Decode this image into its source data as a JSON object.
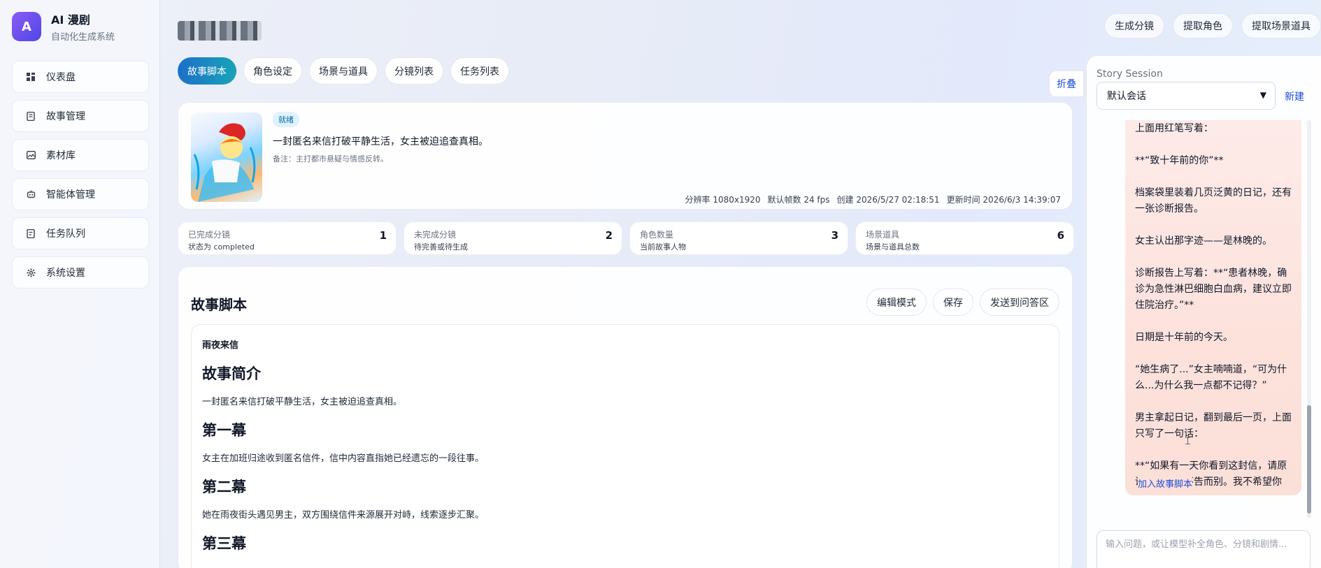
{
  "app": {
    "title": "AI 漫剧",
    "subtitle": "自动化生成系统",
    "logo_letter": "A"
  },
  "sidebar": {
    "items": [
      {
        "label": "仪表盘",
        "icon": "dashboard-icon"
      },
      {
        "label": "故事管理",
        "icon": "book-icon"
      },
      {
        "label": "素材库",
        "icon": "image-icon"
      },
      {
        "label": "智能体管理",
        "icon": "robot-icon"
      },
      {
        "label": "任务队列",
        "icon": "queue-icon"
      },
      {
        "label": "系统设置",
        "icon": "gear-icon"
      }
    ]
  },
  "top_actions": [
    "生成分镜",
    "提取角色",
    "提取场景道具"
  ],
  "tabs": [
    "故事脚本",
    "角色设定",
    "场景与道具",
    "分镜列表",
    "任务列表"
  ],
  "active_tab": 0,
  "story": {
    "status": "就绪",
    "summary": "一封匿名来信打破平静生活，女主被迫追查真相。",
    "note": "备注：主打都市悬疑与情感反转。",
    "resolution": "分辨率 1080x1920",
    "fps": "默认帧数 24 fps",
    "created": "创建 2026/5/27 02:18:51",
    "updated": "更新时间 2026/6/3 14:39:07"
  },
  "stats": [
    {
      "label": "已完成分镜",
      "sub": "状态为 completed",
      "value": "1"
    },
    {
      "label": "未完成分镜",
      "sub": "待完善或待生成",
      "value": "2"
    },
    {
      "label": "角色数量",
      "sub": "当前故事人物",
      "value": "3"
    },
    {
      "label": "场景道具",
      "sub": "场景与道具总数",
      "value": "6"
    }
  ],
  "script": {
    "title": "故事脚本",
    "buttons": [
      "编辑模式",
      "保存",
      "发送到问答区"
    ],
    "doc_title": "雨夜来信",
    "sections": [
      {
        "heading": "故事简介",
        "text": "一封匿名来信打破平静生活，女主被迫追查真相。"
      },
      {
        "heading": "第一幕",
        "text": "女主在加班归途收到匿名信件，信中内容直指她已经遗忘的一段往事。"
      },
      {
        "heading": "第二幕",
        "text": "她在雨夜街头遇见男主，双方围绕信件来源展开对峙，线索逐步汇聚。"
      },
      {
        "heading": "第三幕",
        "text": ""
      }
    ]
  },
  "panel": {
    "fold_label": "折叠",
    "session_label": "Story Session",
    "session_value": "默认会话",
    "new_label": "新建",
    "chat_text": "里面装着一个泛黄的信封，\n上面用红笔写着：\n\n**“致十年前的你”**\n\n档案袋里装着几页泛黄的日记，还有一张诊断报告。\n\n女主认出那字迹——是林晚的。\n\n诊断报告上写着：**“患者林晚，确诊为急性淋巴细胞白血病，建议立即住院治疗。”**\n\n日期是十年前的今天。\n\n“她生病了...”女主喃喃道，“可为什么...为什么我一点都不记得？”\n\n男主拿起日记，翻到最后一页，上面只写了一句话：\n\n**“如果有一天你看到这封信，请原谅我当年的不告而别。我不希望你",
    "add_label": "加入故事脚本",
    "input_placeholder": "输入问题，或让模型补全角色、分镜和剧情..."
  }
}
